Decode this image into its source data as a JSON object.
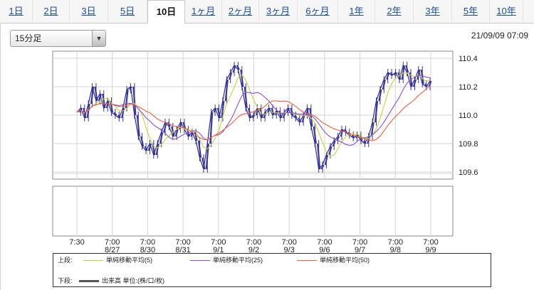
{
  "tabs": [
    {
      "label": "1日",
      "active": false
    },
    {
      "label": "2日",
      "active": false
    },
    {
      "label": "3日",
      "active": false
    },
    {
      "label": "5日",
      "active": false
    },
    {
      "label": "10日",
      "active": true
    },
    {
      "label": "1ヶ月",
      "active": false
    },
    {
      "label": "2ヶ月",
      "active": false
    },
    {
      "label": "3ヶ月",
      "active": false
    },
    {
      "label": "6ヶ月",
      "active": false
    },
    {
      "label": "1年",
      "active": false
    },
    {
      "label": "2年",
      "active": false
    },
    {
      "label": "3年",
      "active": false
    },
    {
      "label": "5年",
      "active": false
    },
    {
      "label": "10年",
      "active": false
    }
  ],
  "interval_select": {
    "value": "15分足"
  },
  "datetime": "21/09/09 07:09",
  "chart_data": {
    "type": "line",
    "price_ticks": [
      "110.4",
      "110.2",
      "110.0",
      "109.8",
      "109.6"
    ],
    "ylim": [
      109.55,
      110.45
    ],
    "x_labels": [
      {
        "time": "7:30",
        "date": ""
      },
      {
        "time": "7:00",
        "date": "8/27"
      },
      {
        "time": "7:00",
        "date": "8/30"
      },
      {
        "time": "7:00",
        "date": "8/31"
      },
      {
        "time": "7:00",
        "date": "9/1"
      },
      {
        "time": "7:00",
        "date": "9/2"
      },
      {
        "time": "7:00",
        "date": "9/3"
      },
      {
        "time": "7:00",
        "date": "9/6"
      },
      {
        "time": "7:00",
        "date": "9/7"
      },
      {
        "time": "7:00",
        "date": "9/8"
      },
      {
        "time": "7:00",
        "date": "9/9"
      }
    ],
    "price_path": [
      110.02,
      110.05,
      109.98,
      110.08,
      110.2,
      110.1,
      110.15,
      110.05,
      110.1,
      110.02,
      110.0,
      109.98,
      110.05,
      110.18,
      110.2,
      110.0,
      109.85,
      109.78,
      109.75,
      109.8,
      109.72,
      109.8,
      109.88,
      109.95,
      109.92,
      109.85,
      109.9,
      109.95,
      109.9,
      109.85,
      109.88,
      109.82,
      109.7,
      109.62,
      109.8,
      110.02,
      110.05,
      109.98,
      110.1,
      110.25,
      110.3,
      110.35,
      110.32,
      110.2,
      110.05,
      109.98,
      110.0,
      110.05,
      109.98,
      110.02,
      110.05,
      110.0,
      110.03,
      109.98,
      110.02,
      110.05,
      110.0,
      109.98,
      109.95,
      110.0,
      110.05,
      109.92,
      109.8,
      109.62,
      109.65,
      109.72,
      109.78,
      109.82,
      109.85,
      109.9,
      109.88,
      109.86,
      109.84,
      109.86,
      109.82,
      109.8,
      109.85,
      109.95,
      110.1,
      110.18,
      110.25,
      110.3,
      110.28,
      110.3,
      110.25,
      110.35,
      110.3,
      110.2,
      110.25,
      110.32,
      110.22,
      110.2,
      110.24
    ],
    "series": [
      {
        "name": "単純移動平均(5)",
        "color": "#c8d23a",
        "window": 5
      },
      {
        "name": "単純移動平均(25)",
        "color": "#8a4fd8",
        "window": 10
      },
      {
        "name": "単純移動平均(50)",
        "color": "#f06040",
        "window": 17
      }
    ]
  },
  "legend": {
    "upper_label": "上段:",
    "lower_label": "下段:",
    "upper_items": [
      {
        "label": "単純移動平均(5)",
        "color": "#c8d23a"
      },
      {
        "label": "単純移動平均(25)",
        "color": "#8a4fd8"
      },
      {
        "label": "単純移動平均(50)",
        "color": "#f06040"
      }
    ],
    "lower_item": {
      "label": "出来高 単位:(株/口/枚)",
      "color": "#555555"
    }
  }
}
